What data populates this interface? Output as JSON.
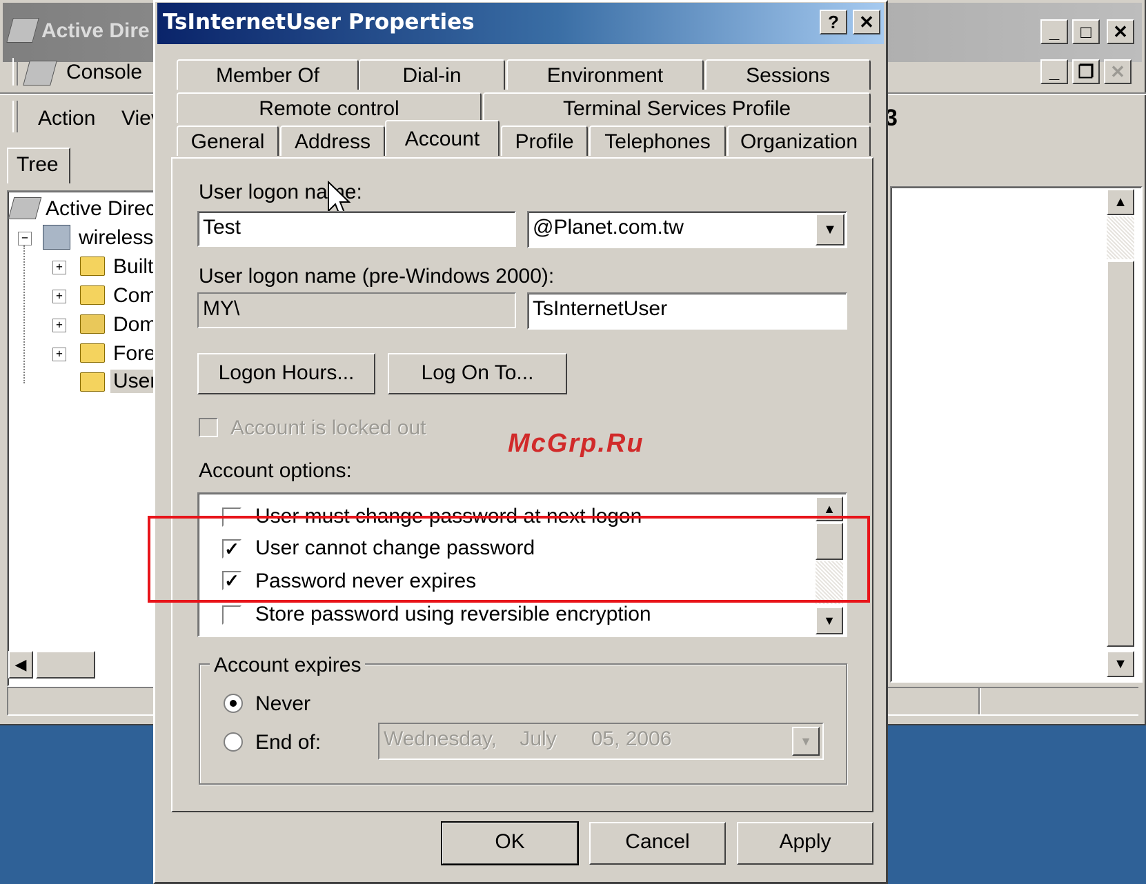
{
  "mmc": {
    "title": "Active Dire",
    "menu_console": "Console",
    "menu_action": "Action",
    "menu_view": "Viev",
    "tab_tree": "Tree",
    "tree": {
      "root": "Active Direct",
      "domain": "wireless.",
      "items": [
        "Builti",
        "Com",
        "Dom",
        "Fore",
        "User"
      ]
    }
  },
  "dialog": {
    "title": "TsInternetUser Properties",
    "help_button": "?",
    "close_button": "✕",
    "tabs_row1": [
      "Member Of",
      "Dial-in",
      "Environment",
      "Sessions"
    ],
    "tabs_row2": [
      "Remote control",
      "Terminal Services Profile"
    ],
    "tabs_row3": [
      "General",
      "Address",
      "Account",
      "Profile",
      "Telephones",
      "Organization"
    ],
    "active_tab": "Account",
    "account": {
      "logon_name_label": "User logon name:",
      "logon_name_value": "Test",
      "domain_value": "@Planet.com.tw",
      "pre2000_label": "User logon name (pre-Windows 2000):",
      "pre2000_domain": "MY\\",
      "pre2000_user": "TsInternetUser",
      "logon_hours_button": "Logon Hours...",
      "log_on_to_button": "Log On To...",
      "locked_out_label": "Account is locked out",
      "options_label": "Account options:",
      "options": [
        {
          "label": "User must change password at next logon",
          "checked": false
        },
        {
          "label": "User cannot change password",
          "checked": true
        },
        {
          "label": "Password never expires",
          "checked": true
        },
        {
          "label": "Store password using reversible encryption",
          "checked": false
        }
      ],
      "expires_label": "Account expires",
      "never_label": "Never",
      "end_of_label": "End of:",
      "end_of_date": "Wednesday,    July      05, 2006"
    },
    "ok_button": "OK",
    "cancel_button": "Cancel",
    "apply_button": "Apply"
  },
  "watermark": "McGrp.Ru",
  "colors": {
    "desktop": "#2f6197",
    "face": "#d4d0c8",
    "title_active": "#0a246a",
    "highlight": "#e8141a",
    "watermark": "#d12a2a"
  }
}
